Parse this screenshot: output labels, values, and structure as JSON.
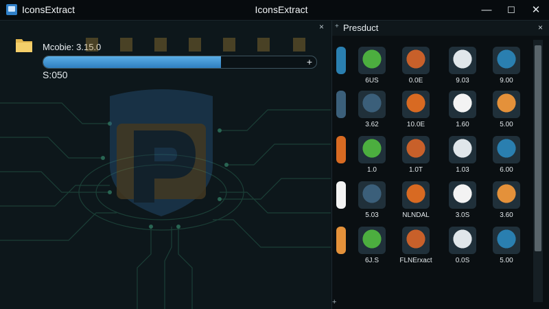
{
  "window": {
    "title_left": "IconsExtract",
    "title_center": "IconsExtract",
    "minimize_glyph": "—",
    "maximize_glyph": "☐",
    "close_glyph": "✕"
  },
  "left_pane": {
    "close_glyph": "×",
    "scan_label": "Mcobie: 3.15.0",
    "progress_fraction": 0.65,
    "progress_plus": "+",
    "status_text": "S:050"
  },
  "right_pane": {
    "title": "Presduct",
    "close_glyph": "×",
    "pin_glyph": "+",
    "corner_plus": "+",
    "rows": [
      {
        "labels": [
          "6US",
          "0.0E",
          "9.03",
          "9.00"
        ]
      },
      {
        "labels": [
          "3.62",
          "10.0E",
          "1.60",
          "5.00"
        ]
      },
      {
        "labels": [
          "1.0",
          "1.0T",
          "1.03",
          "6.00"
        ]
      },
      {
        "labels": [
          "5.03",
          "NLNDAL",
          "3.0S",
          "3.60"
        ]
      },
      {
        "labels": [
          "6J.S",
          "FLNErxact",
          "0.0S",
          "5.00"
        ]
      }
    ],
    "row_icons": [
      [
        "leaf-icon",
        "flag-icon",
        "media-icon",
        "arrow-icon"
      ],
      [
        "toolbox-icon",
        "camera-icon",
        "star-icon",
        "play-icon"
      ],
      [
        "monitor-icon",
        "disc-icon",
        "monitor-icon",
        "disc-icon"
      ],
      [
        "leaf-icon",
        "tools-icon",
        "flag-icon",
        "refresh-icon"
      ],
      [
        "target-icon",
        "chrome-icon",
        "arrow-icon",
        "media-icon"
      ]
    ],
    "colors": [
      "#4cae3f",
      "#c8602a",
      "#e0e6ea",
      "#2a7fb0",
      "#3b5f7a",
      "#d86a22",
      "#f3f3f3",
      "#e4913a"
    ]
  }
}
